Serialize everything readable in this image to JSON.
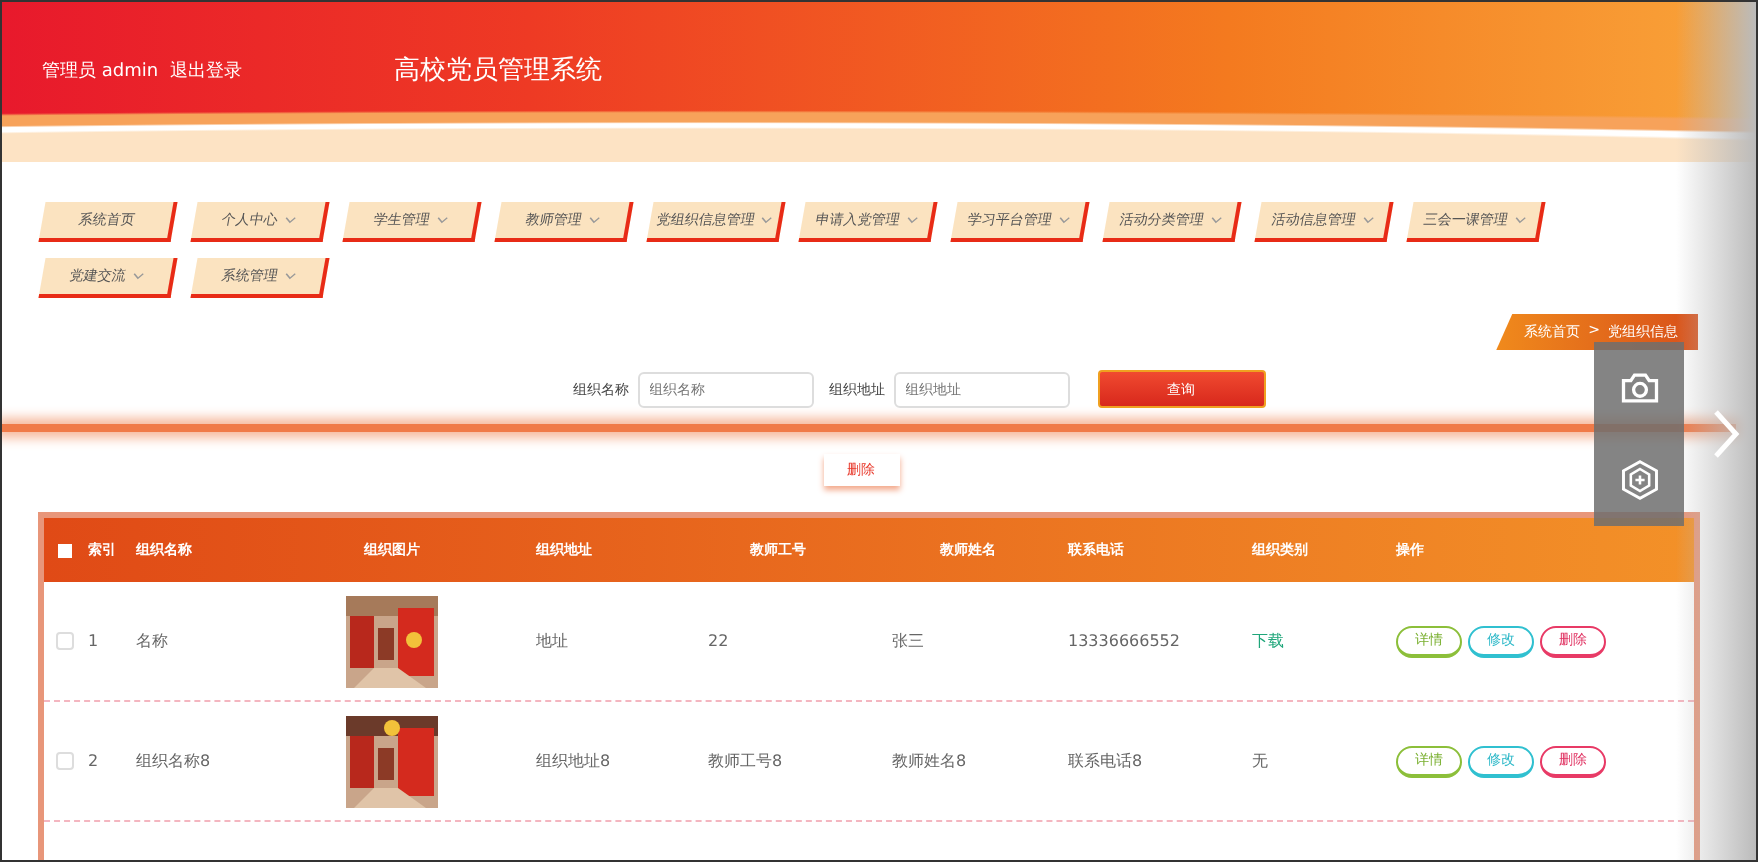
{
  "header": {
    "user": "管理员 admin",
    "logout": "退出登录",
    "title": "高校党员管理系统"
  },
  "nav": [
    {
      "label": "系统首页",
      "dropdown": false
    },
    {
      "label": "个人中心",
      "dropdown": true
    },
    {
      "label": "学生管理",
      "dropdown": true
    },
    {
      "label": "教师管理",
      "dropdown": true
    },
    {
      "label": "党组织信息管理",
      "dropdown": true
    },
    {
      "label": "申请入党管理",
      "dropdown": true
    },
    {
      "label": "学习平台管理",
      "dropdown": true
    },
    {
      "label": "活动分类管理",
      "dropdown": true
    },
    {
      "label": "活动信息管理",
      "dropdown": true
    },
    {
      "label": "三会一课管理",
      "dropdown": true
    },
    {
      "label": "党建交流",
      "dropdown": true
    },
    {
      "label": "系统管理",
      "dropdown": true
    }
  ],
  "breadcrumb": {
    "home": "系统首页",
    "separator": ">",
    "current": "党组织信息"
  },
  "search": {
    "fields": [
      {
        "label": "组织名称",
        "placeholder": "组织名称"
      },
      {
        "label": "组织地址",
        "placeholder": "组织地址"
      }
    ],
    "button": "查询"
  },
  "delete_button": "删除",
  "table": {
    "select_all_checked": false,
    "columns": [
      "索引",
      "组织名称",
      "组织图片",
      "组织地址",
      "教师工号",
      "教师姓名",
      "联系电话",
      "组织类别",
      "操作"
    ],
    "rows": [
      {
        "checked": false,
        "index": "1",
        "name": "名称",
        "address": "地址",
        "teacher_id": "22",
        "teacher_name": "张三",
        "phone": "13336666552",
        "category": "下载",
        "actions": [
          "详情",
          "修改",
          "删除"
        ]
      },
      {
        "checked": false,
        "index": "2",
        "name": "组织名称8",
        "address": "组织地址8",
        "teacher_id": "教师工号8",
        "teacher_name": "教师姓名8",
        "phone": "联系电话8",
        "category": "无",
        "actions": [
          "详情",
          "修改",
          "删除"
        ]
      }
    ]
  }
}
